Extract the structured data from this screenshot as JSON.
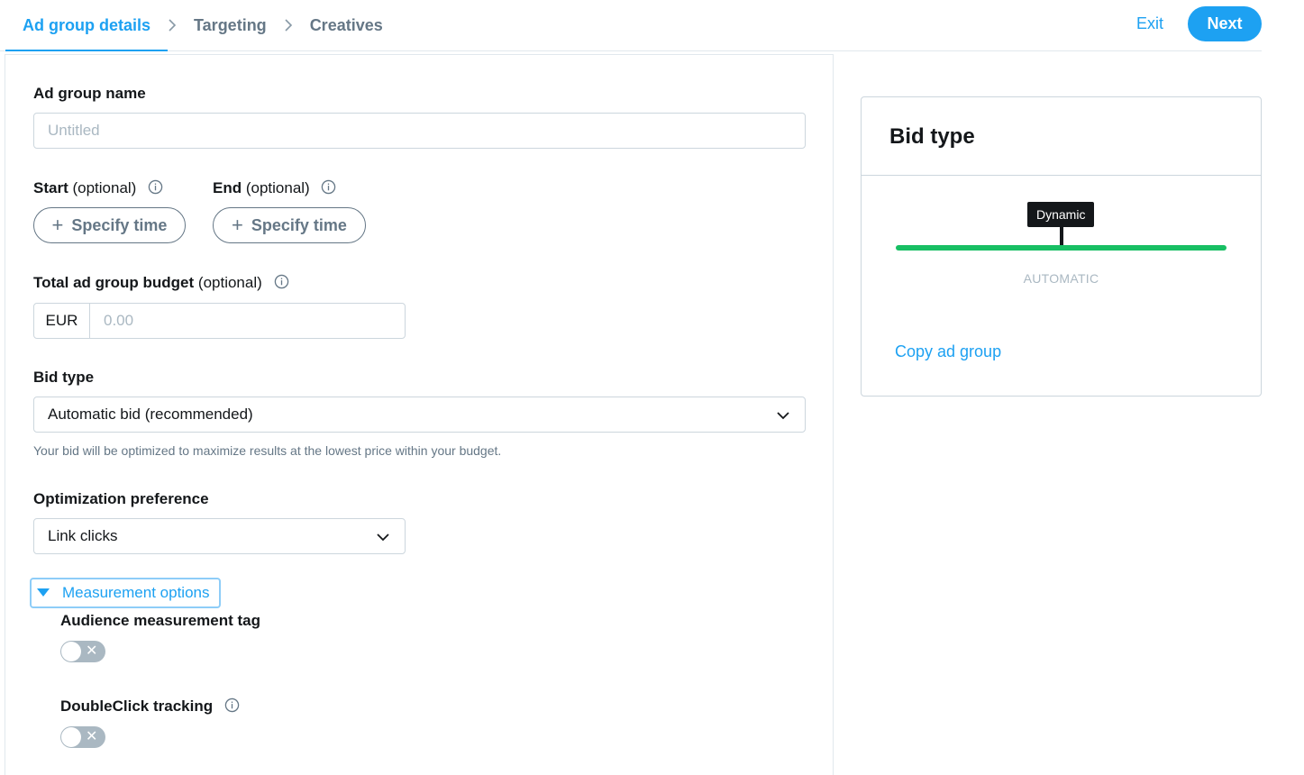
{
  "header": {
    "breadcrumbs": [
      {
        "label": "Ad group details",
        "active": true
      },
      {
        "label": "Targeting",
        "active": false
      },
      {
        "label": "Creatives",
        "active": false
      }
    ],
    "exit_label": "Exit",
    "next_label": "Next"
  },
  "form": {
    "ad_group_name": {
      "label": "Ad group name",
      "placeholder": "Untitled",
      "value": ""
    },
    "start": {
      "label": "Start",
      "optional": "(optional)",
      "button_label": "Specify time"
    },
    "end": {
      "label": "End",
      "optional": "(optional)",
      "button_label": "Specify time"
    },
    "budget": {
      "label": "Total ad group budget",
      "optional": "(optional)",
      "currency": "EUR",
      "placeholder": "0.00"
    },
    "bid_type": {
      "label": "Bid type",
      "selected": "Automatic bid (recommended)",
      "helper": "Your bid will be optimized to maximize results at the lowest price within your budget."
    },
    "optimization": {
      "label": "Optimization preference",
      "selected": "Link clicks"
    },
    "measurement": {
      "toggle_label": "Measurement options",
      "audience_tag": {
        "label": "Audience measurement tag",
        "enabled": false
      },
      "doubleclick": {
        "label": "DoubleClick tracking",
        "enabled": false
      }
    }
  },
  "side_card": {
    "title": "Bid type",
    "tooltip": "Dynamic",
    "caption": "AUTOMATIC",
    "copy_link": "Copy ad group"
  },
  "colors": {
    "accent": "#1da1f2",
    "success": "#17bf63",
    "muted": "#657786",
    "border": "#ccd6dd"
  }
}
